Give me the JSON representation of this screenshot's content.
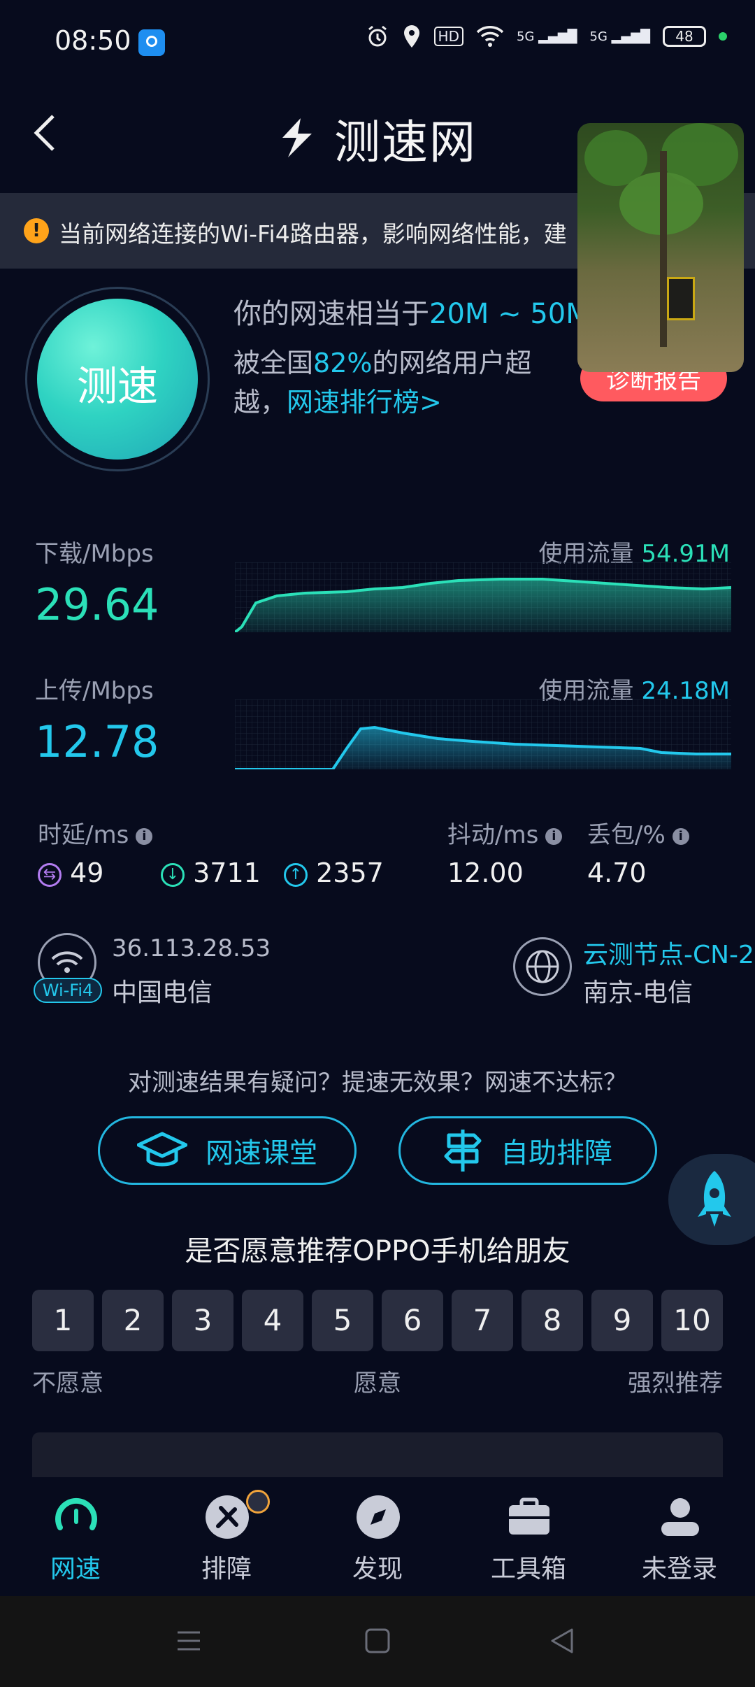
{
  "status_bar": {
    "time": "08:50",
    "hd_label": "HD",
    "net1": "5G",
    "net2": "5G",
    "battery": "48"
  },
  "header": {
    "title": "测速网"
  },
  "warning": {
    "text": "当前网络连接的Wi-Fi4路由器，影响网络性能，建"
  },
  "speed_button": {
    "label": "测速"
  },
  "summary": {
    "equiv_prefix": "你的网速相当于",
    "equiv_value": "20M ~ 50M",
    "beat_prefix": "被全国",
    "beat_percent": "82%",
    "beat_suffix": "的网络用户超",
    "beat_line2_prefix": "越，",
    "ranking_link": "网速排行榜>",
    "diagnosis_button": "诊断报告"
  },
  "download": {
    "label": "下载/Mbps",
    "value": "29.64",
    "usage_label": "使用流量",
    "usage_value": "54.91M",
    "color": "#2be0b8"
  },
  "upload": {
    "label": "上传/Mbps",
    "value": "12.78",
    "usage_label": "使用流量",
    "usage_value": "24.18M",
    "color": "#23c8ec"
  },
  "latency": {
    "label": "时延/ms",
    "idle": "49",
    "down": "3711",
    "up": "2357",
    "jitter_label": "抖动/ms",
    "jitter": "12.00",
    "loss_label": "丢包/%",
    "loss": "4.70",
    "info_glyph": "i"
  },
  "network": {
    "ip": "36.113.28.53",
    "wifi_badge": "Wi-Fi4",
    "isp": "中国电信",
    "node": "云测节点-CN-2",
    "node_location": "南京-电信"
  },
  "help": {
    "question": "对测速结果有疑问？提速无效果？网速不达标？",
    "class_button": "网速课堂",
    "troubleshoot_button": "自助排障"
  },
  "rating": {
    "question": "是否愿意推荐OPPO手机给朋友",
    "options": [
      "1",
      "2",
      "3",
      "4",
      "5",
      "6",
      "7",
      "8",
      "9",
      "10"
    ],
    "low_label": "不愿意",
    "mid_label": "愿意",
    "high_label": "强烈推荐"
  },
  "bottom_nav": {
    "items": [
      {
        "label": "网速"
      },
      {
        "label": "排障"
      },
      {
        "label": "发现"
      },
      {
        "label": "工具箱"
      },
      {
        "label": "未登录"
      }
    ]
  },
  "colors": {
    "accent": "#23c8ec",
    "download": "#2be0b8",
    "warning": "#ffa31a",
    "diagnosis": "#ff5a5f"
  }
}
